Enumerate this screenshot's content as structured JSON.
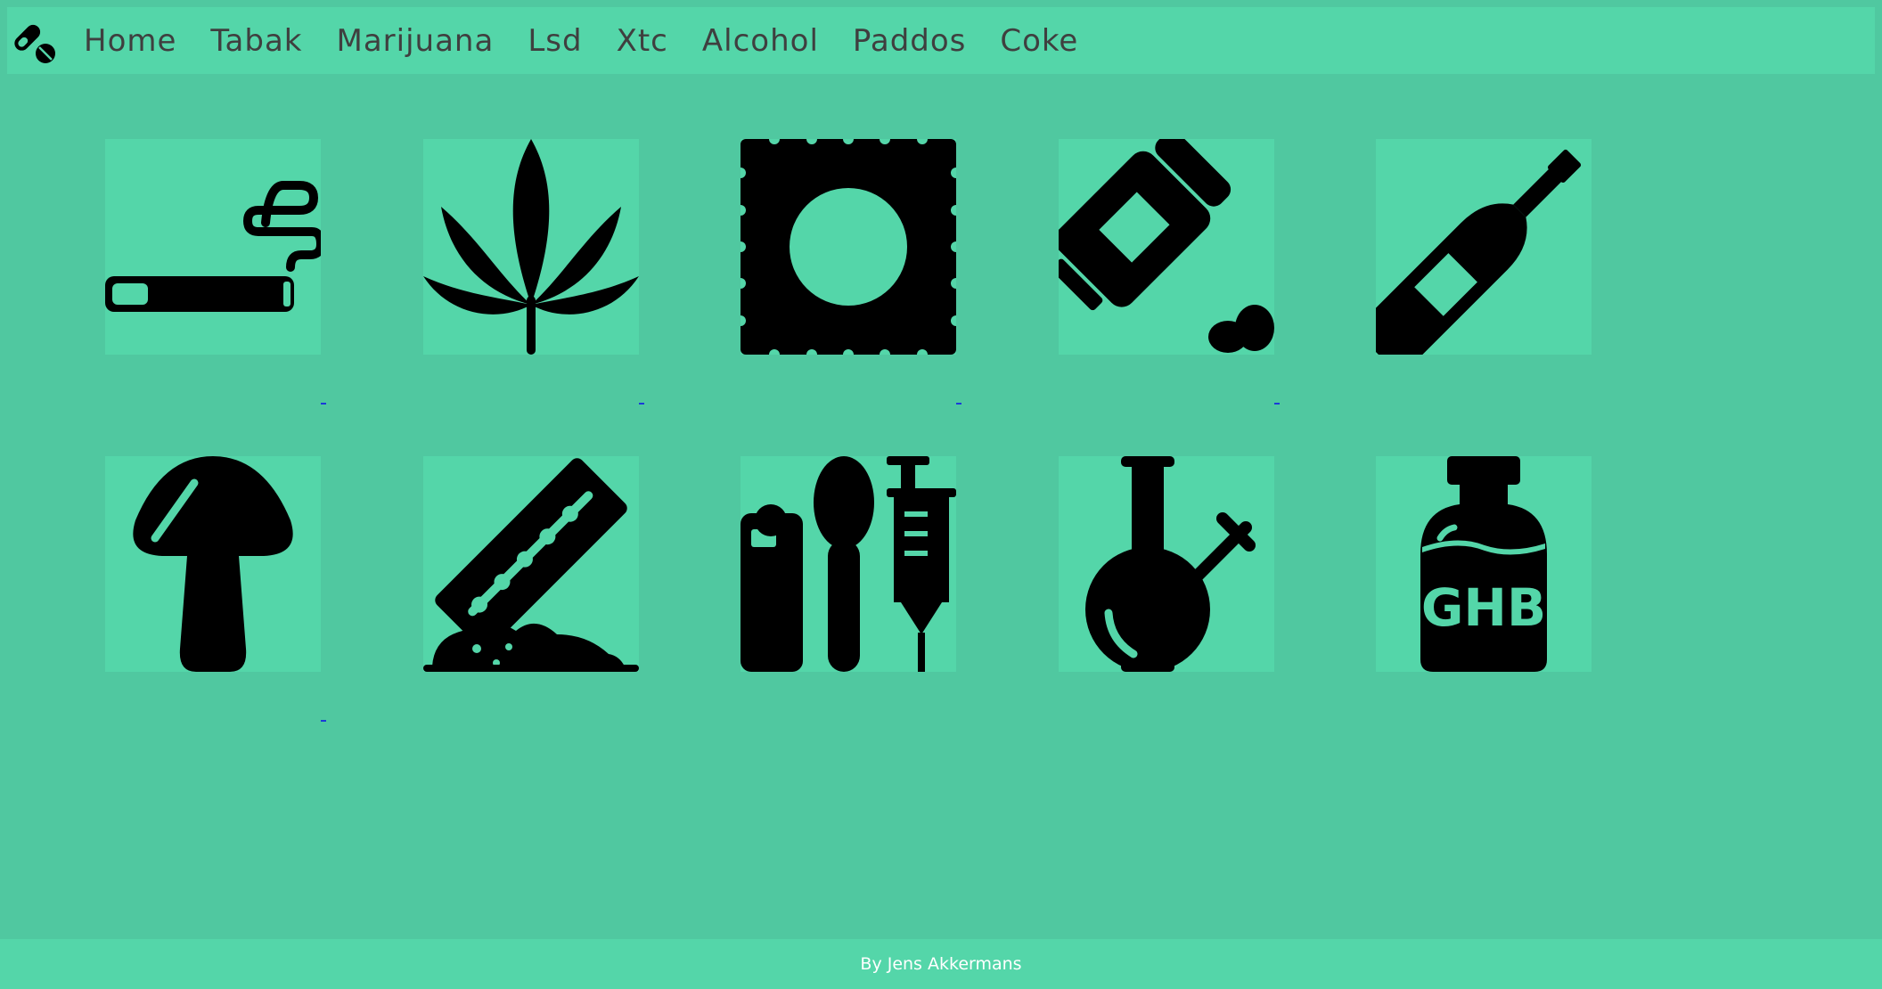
{
  "nav": {
    "logo_icon": "pills-icon",
    "items": [
      {
        "label": "Home"
      },
      {
        "label": "Tabak"
      },
      {
        "label": "Marijuana"
      },
      {
        "label": "Lsd"
      },
      {
        "label": "Xtc"
      },
      {
        "label": "Alcohol"
      },
      {
        "label": "Paddos"
      },
      {
        "label": "Coke"
      }
    ]
  },
  "tiles": [
    {
      "icon": "cigarette-icon"
    },
    {
      "icon": "cannabis-leaf-icon"
    },
    {
      "icon": "lsd-stamp-icon"
    },
    {
      "icon": "pill-bottle-icon"
    },
    {
      "icon": "wine-bottle-icon"
    },
    {
      "icon": "mushroom-icon"
    },
    {
      "icon": "razor-blade-powder-icon"
    },
    {
      "icon": "lighter-spoon-syringe-icon"
    },
    {
      "icon": "bong-icon"
    },
    {
      "icon": "ghb-bottle-icon"
    }
  ],
  "ghb_label": "GHB",
  "footer": {
    "text": "By Jens Akkermans"
  },
  "colors": {
    "background": "#50c8a0",
    "bar": "#54d6a9",
    "icon": "#000000",
    "nav_text": "#3f3f3f",
    "footer_text": "#ffffff"
  }
}
